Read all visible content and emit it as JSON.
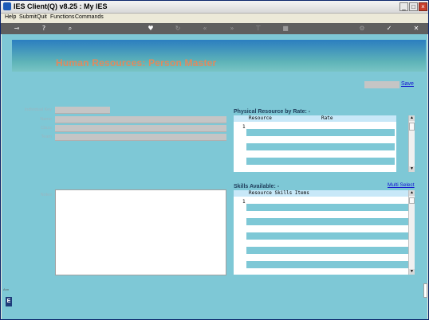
{
  "window": {
    "title": "IES Client(Q) v8.25 : My IES",
    "minimize": "_",
    "maximize": "□",
    "close": "×"
  },
  "menu": [
    "Help",
    "Submit",
    "Quit",
    "Functions",
    "Commands"
  ],
  "toolbar": {
    "icons": [
      "key-icon",
      "help-icon",
      "search-icon",
      "heart-icon",
      "refresh-icon",
      "prev-icon",
      "next-icon",
      "pin-icon",
      "stop-icon",
      "settings-icon",
      "check-icon",
      "close-icon"
    ],
    "glyphs": [
      "⊸",
      "?",
      "⌕",
      "♥",
      "↻",
      "«",
      "»",
      "⊤",
      "■",
      "⚙",
      "✓",
      "✕"
    ]
  },
  "banner": {
    "title": "Human Resources: Person Master"
  },
  "actions": {
    "save_label": "Save",
    "multi_select_label": "Multi Select"
  },
  "form": {
    "labels": {
      "individual_key": "Individual Key",
      "name": "Name",
      "class": "Class",
      "team": "Team",
      "notes": "Notes"
    },
    "values": {
      "individual_key": "",
      "name": "",
      "class": "",
      "team": "",
      "notes": ""
    }
  },
  "physical_resource": {
    "title": "Physical Resource by Rate: -",
    "columns": [
      "Resource",
      "Rate"
    ],
    "row_number": "1"
  },
  "skills": {
    "title": "Skills Available: -",
    "columns": [
      "Resource Skills Items"
    ],
    "row_number": "1"
  },
  "side": {
    "letter": "E",
    "tiny": "Ann"
  },
  "colors": {
    "background": "#7ec8d6",
    "link": "#1010d0",
    "title_text": "#e08a5e"
  }
}
